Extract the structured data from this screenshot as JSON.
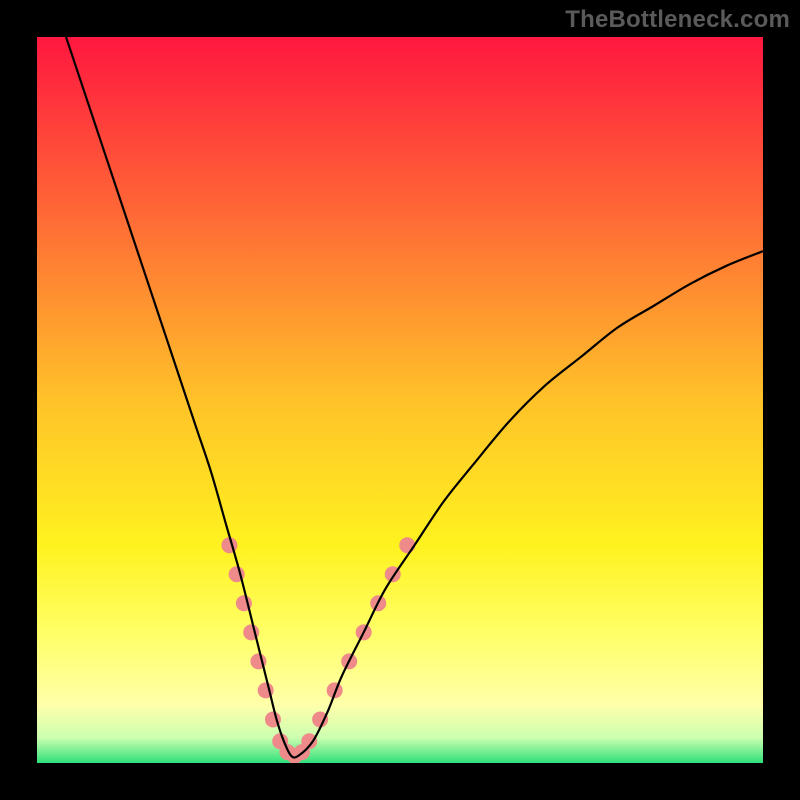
{
  "watermark": "TheBottleneck.com",
  "chart_data": {
    "type": "line",
    "title": "",
    "xlabel": "",
    "ylabel": "",
    "xlim": [
      0,
      100
    ],
    "ylim": [
      0,
      100
    ],
    "grid": false,
    "background_gradient": {
      "stops": [
        {
          "offset": 0.0,
          "color": "#ff173f"
        },
        {
          "offset": 0.25,
          "color": "#ff6b36"
        },
        {
          "offset": 0.5,
          "color": "#ffc229"
        },
        {
          "offset": 0.7,
          "color": "#fff21f"
        },
        {
          "offset": 0.82,
          "color": "#ffff66"
        },
        {
          "offset": 0.92,
          "color": "#ffffaa"
        },
        {
          "offset": 0.965,
          "color": "#ccffb0"
        },
        {
          "offset": 1.0,
          "color": "#2fe07a"
        }
      ]
    },
    "series": [
      {
        "name": "bottleneck-curve",
        "color": "#000000",
        "width": 2.2,
        "x": [
          4,
          6,
          8,
          10,
          12,
          14,
          16,
          18,
          20,
          22,
          24,
          26,
          28,
          30,
          31,
          32,
          33,
          34,
          35,
          36,
          38,
          40,
          42,
          45,
          48,
          52,
          56,
          60,
          65,
          70,
          75,
          80,
          85,
          90,
          95,
          100
        ],
        "y": [
          100,
          94,
          88,
          82,
          76,
          70,
          64,
          58,
          52,
          46,
          40,
          33,
          26,
          18,
          14,
          10,
          6,
          3,
          1,
          1,
          3,
          7,
          12,
          18,
          24,
          30,
          36,
          41,
          47,
          52,
          56,
          60,
          63,
          66,
          68.5,
          70.5
        ]
      }
    ],
    "markers": {
      "name": "pink-beads",
      "color": "#ef8a8a",
      "radius": 8,
      "points": [
        {
          "x": 26.5,
          "y": 30
        },
        {
          "x": 27.5,
          "y": 26
        },
        {
          "x": 28.5,
          "y": 22
        },
        {
          "x": 29.5,
          "y": 18
        },
        {
          "x": 30.5,
          "y": 14
        },
        {
          "x": 31.5,
          "y": 10
        },
        {
          "x": 32.5,
          "y": 6
        },
        {
          "x": 33.5,
          "y": 3
        },
        {
          "x": 34.5,
          "y": 1.5
        },
        {
          "x": 35.5,
          "y": 1
        },
        {
          "x": 36.5,
          "y": 1.5
        },
        {
          "x": 37.5,
          "y": 3
        },
        {
          "x": 39.0,
          "y": 6
        },
        {
          "x": 41.0,
          "y": 10
        },
        {
          "x": 43.0,
          "y": 14
        },
        {
          "x": 45.0,
          "y": 18
        },
        {
          "x": 47.0,
          "y": 22
        },
        {
          "x": 49.0,
          "y": 26
        },
        {
          "x": 51.0,
          "y": 30
        }
      ]
    }
  }
}
